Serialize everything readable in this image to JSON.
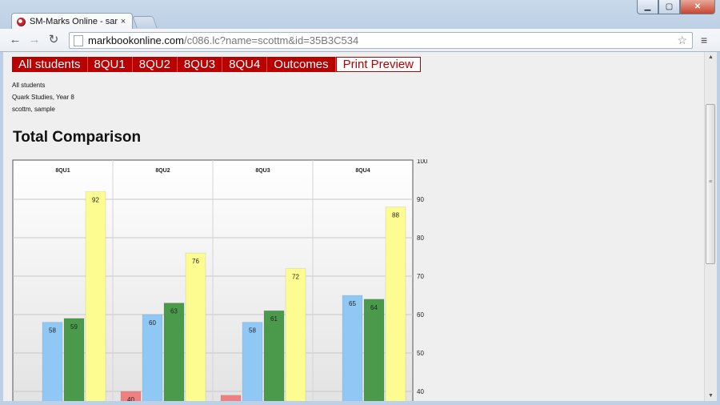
{
  "browser": {
    "tab_title": "SM-Marks Online - sample",
    "tab_close": "×",
    "url_host": "markbookonline.com",
    "url_path": "/c086.lc?name=scottm&id=35B3C534",
    "icons": [
      "back-icon",
      "forward-icon",
      "reload-icon",
      "page-icon",
      "star-icon",
      "menu-icon",
      "minimize-icon",
      "maximize-icon",
      "close-icon"
    ]
  },
  "nav": {
    "items": [
      "All students",
      "8QU1",
      "8QU2",
      "8QU3",
      "8QU4",
      "Outcomes",
      "Print Preview"
    ],
    "active_index": 6
  },
  "meta": {
    "group": "All students",
    "course": "Quark Studies, Year 8",
    "user": "scottm, sample"
  },
  "page_title": "Total Comparison",
  "colors": {
    "nav_bg": "#b90000",
    "series": [
      "#f08080",
      "#90c8f5",
      "#4b9a4b",
      "#fcfc90"
    ]
  },
  "chart_data": {
    "type": "bar",
    "categories": [
      "8QU1",
      "8QU2",
      "8QU3",
      "8QU4"
    ],
    "series": [
      {
        "name": "",
        "values": [
          null,
          40,
          39,
          null
        ],
        "labels": [
          "",
          "40",
          "",
          ""
        ]
      },
      {
        "name": "",
        "values": [
          58,
          60,
          58,
          65
        ],
        "labels": [
          "58",
          "60",
          "58",
          "65"
        ]
      },
      {
        "name": "",
        "values": [
          59,
          63,
          61,
          64
        ],
        "labels": [
          "59",
          "63",
          "61",
          "64"
        ]
      },
      {
        "name": "",
        "values": [
          92,
          76,
          72,
          88
        ],
        "labels": [
          "92",
          "76",
          "72",
          "88"
        ]
      }
    ],
    "yticks": [
      40,
      50,
      60,
      70,
      80,
      90,
      100
    ],
    "ylim": [
      37.5,
      100
    ],
    "grid": true,
    "y_axis_side": "right"
  }
}
